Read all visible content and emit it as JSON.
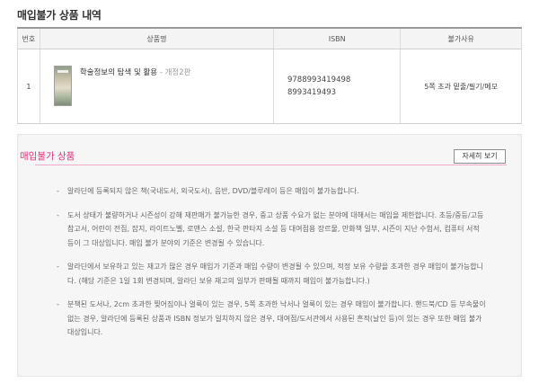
{
  "page_title": "매입불가 상품 내역",
  "table": {
    "headers": [
      "번호",
      "상품명",
      "ISBN",
      "불가사유"
    ],
    "rows": [
      {
        "no": "1",
        "product_name": "학술정보의 탐색 및 활용",
        "edition": " - 개정2판",
        "isbn": [
          "9788993419498",
          "8993419493"
        ],
        "reason": "5쪽 초과 밑줄/필기/메모"
      }
    ]
  },
  "info_box": {
    "title": "매입불가 상품",
    "more_button": "자세히 보기",
    "notes": [
      "알라딘에 등록되지 않은 책(국내도서, 외국도서), 음반, DVD/블루레이 등은 매입이 불가능합니다.",
      "도서 상태가 불량하거나 시즌성이 강해 재판매가 불가능한 경우, 중고 상품 수요가 없는 분야에 대해서는 매입을 제한합니다. 초등/중등/고등 참고서, 어린이 전집, 잡지, 라이트노벨, 로맨스 소설, 한국 판타지 소설 등 대여점용 장르물, 만화책 일부, 시즌이 지난 수험서, 컴퓨터 서적 등이 그 대상입니다. 매입 불가 분야의 기준은 변경될 수 있습니다.",
      "알라딘에서 보유하고 있는 재고가 많은 경우 매입가 기준과 매입 수량이 변경될 수 있으며, 적정 보유 수량을 초과한 경우 매입이 불가능합니다. (해당 기준은 1일 1회 변경되며, 알라딘 보유 재고의 일부가 판매될 때까지 매입이 불가능합니다.)",
      "분책된 도서나, 2cm 초과한 찢어짐이나 얼룩이 있는 경우, 5쪽 초과한 낙서나 얼룩이 있는 경우 매입이 불가합니다. 핸드북/CD 등 부속물이 없는 경우, 알라딘에 등록된 상품과 ISBN 정보가 일치하지 않은 경우, 대여점/도서관에서 사용된 흔적(날인 등)이 있는 경우 또한 매입 불가 대상입니다."
    ]
  },
  "colors": {
    "accent": "#e2327a",
    "rule": "#f3a9c8"
  }
}
